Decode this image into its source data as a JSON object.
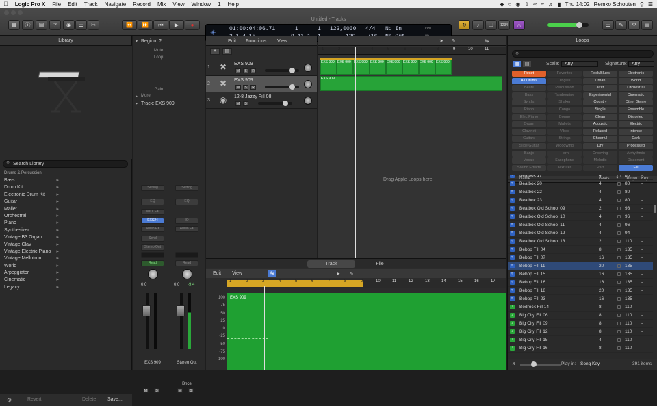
{
  "menubar": {
    "apple": "",
    "app": "Logic Pro X",
    "items": [
      "File",
      "Edit",
      "Track",
      "Navigate",
      "Record",
      "Mix",
      "View",
      "Window",
      "1",
      "Help"
    ],
    "clock": "Thu 14:02",
    "user": "Remko Schouten"
  },
  "window_title": "Untitled - Tracks",
  "lcd": {
    "time": "01:00:04:06.71",
    "bars1": "1",
    "time_end": "1",
    "tempo": "123,0000",
    "signature": "4/4",
    "midi_in": "No In",
    "position": "3  1  4     15",
    "bars2": "9  11  1",
    "bars3": "1",
    "tempo2": "129",
    "division": "/16",
    "midi_out": "No Out",
    "cpu": "CPU",
    "hd": "HD"
  },
  "library": {
    "title": "Library",
    "search_placeholder": "Search Library",
    "category": "Drums & Percussion",
    "items": [
      "Bass",
      "Drum Kit",
      "Electronic Drum Kit",
      "Guitar",
      "Mallet",
      "Orchestral",
      "Piano",
      "Synthesizer",
      "Vintage B3 Organ",
      "Vintage Clav",
      "Vintage Electric Piano",
      "Vintage Mellotron",
      "World",
      "Arpeggiator",
      "Cinematic",
      "Legacy"
    ],
    "revert": "Revert",
    "delete": "Delete",
    "save": "Save..."
  },
  "inspector": {
    "region": "Region: ?",
    "mute": "Mute:",
    "loop": "Loop:",
    "gain": "Gain:",
    "more": "More",
    "track": "Track:  EXS 909",
    "strip1": {
      "setting": "Setting",
      "eq": "EQ",
      "midi_fx": "MIDI FX",
      "instrument": "EXS24",
      "audio_fx": "Audio FX",
      "send": "Send",
      "output": "Stereo Out",
      "read": "Read",
      "vol": "0,0",
      "pan": "0,0",
      "name": "EXS 909",
      "m": "M",
      "s": "S"
    },
    "strip2": {
      "setting": "Setting",
      "eq": "EQ",
      "instrument": "IO",
      "audio_fx": "Audio FX",
      "read": "Read",
      "vol": "0,0",
      "peak": "-9,4",
      "bnce": "Bnce",
      "name": "Stereo Out",
      "m": "M",
      "s": "S"
    }
  },
  "tracks_header": {
    "edit": "Edit",
    "functions": "Functions",
    "view": "View"
  },
  "tracks": [
    {
      "num": "1",
      "name": "EXS 909",
      "m": "M",
      "s": "S",
      "r": "R"
    },
    {
      "num": "2",
      "name": "EXS 909",
      "m": "M",
      "s": "S",
      "r": "R"
    },
    {
      "num": "3",
      "name": "12-8 Jazzy Fill 08",
      "m": "M",
      "s": "S",
      "r": ""
    }
  ],
  "arrange": {
    "ruler": [
      "1",
      "2",
      "3",
      "4",
      "5",
      "6",
      "7",
      "8",
      "9",
      "10",
      "11"
    ],
    "region_label": "EXS 909",
    "region2_label": "EXS 909",
    "drag_hint": "Drag Apple Loops here."
  },
  "bottom": {
    "tab_track": "Track",
    "tab_file": "File",
    "edit": "Edit",
    "view": "View",
    "ruler": [
      "1",
      "2",
      "3",
      "4",
      "5",
      "6",
      "7",
      "8",
      "9",
      "10",
      "11",
      "12",
      "13",
      "14",
      "15",
      "16",
      "17"
    ],
    "region": "EXS 909",
    "scale": [
      "100",
      "75",
      "50",
      "25",
      "0",
      "-25",
      "-50",
      "-75",
      "-100"
    ]
  },
  "loops": {
    "title": "Loops",
    "scale_label": "Scale:",
    "scale_value": "Any",
    "sig_label": "Signature:",
    "sig_value": "Any",
    "tags_left": [
      [
        "Reset",
        "Favorites"
      ],
      [
        "All Drums",
        "Jingles"
      ],
      [
        "Beats",
        "Percussion"
      ],
      [
        "Bass",
        "Tambourine"
      ],
      [
        "Synths",
        "Shaker"
      ],
      [
        "Piano",
        "Conga"
      ],
      [
        "Elec Piano",
        "Bongo"
      ],
      [
        "Organ",
        "Mallets"
      ],
      [
        "Clavinet",
        "Vibes"
      ],
      [
        "Guitars",
        "Strings"
      ],
      [
        "Slide Guitar",
        "Woodwind"
      ],
      [
        "Banjo",
        "Horn"
      ],
      [
        "Vocals",
        "Saxophone"
      ],
      [
        "Sound Effects",
        "Textures"
      ]
    ],
    "tags_right": [
      [
        "Rock/Blues",
        "Electronic"
      ],
      [
        "Urban",
        "World"
      ],
      [
        "Jazz",
        "Orchestral"
      ],
      [
        "Experimental",
        "Cinematic"
      ],
      [
        "Country",
        "Other Genre"
      ],
      [
        "Single",
        "Ensemble"
      ],
      [
        "Clean",
        "Distorted"
      ],
      [
        "Acoustic",
        "Electric"
      ],
      [
        "Relaxed",
        "Intense"
      ],
      [
        "Cheerful",
        "Dark"
      ],
      [
        "Dry",
        "Processed"
      ],
      [
        "Grooving",
        "Arrhythmic"
      ],
      [
        "Melodic",
        "Dissonant"
      ],
      [
        "Part",
        "Fill"
      ]
    ],
    "col_name": "Name",
    "col_beats": "Beats",
    "col_tempo": "Tempo",
    "col_key": "Key",
    "rows": [
      {
        "name": "Beatbox 17",
        "beats": "4",
        "tempo": "80",
        "key": "-",
        "type": "audio"
      },
      {
        "name": "Beatbox 20",
        "beats": "4",
        "tempo": "80",
        "key": "-",
        "type": "audio"
      },
      {
        "name": "Beatbox 22",
        "beats": "4",
        "tempo": "80",
        "key": "-",
        "type": "audio"
      },
      {
        "name": "Beatbox 23",
        "beats": "4",
        "tempo": "80",
        "key": "-",
        "type": "audio"
      },
      {
        "name": "Beatbox Old School 09",
        "beats": "2",
        "tempo": "98",
        "key": "-",
        "type": "audio"
      },
      {
        "name": "Beatbox Old School 10",
        "beats": "4",
        "tempo": "96",
        "key": "-",
        "type": "audio"
      },
      {
        "name": "Beatbox Old School 11",
        "beats": "4",
        "tempo": "96",
        "key": "-",
        "type": "audio"
      },
      {
        "name": "Beatbox Old School 12",
        "beats": "4",
        "tempo": "94",
        "key": "-",
        "type": "audio"
      },
      {
        "name": "Beatbox Old School 13",
        "beats": "2",
        "tempo": "110",
        "key": "-",
        "type": "audio"
      },
      {
        "name": "Bebop Fill 04",
        "beats": "8",
        "tempo": "135",
        "key": "-",
        "type": "audio"
      },
      {
        "name": "Bebop Fill 07",
        "beats": "16",
        "tempo": "135",
        "key": "-",
        "type": "audio"
      },
      {
        "name": "Bebop Fill 11",
        "beats": "20",
        "tempo": "135",
        "key": "-",
        "type": "audio"
      },
      {
        "name": "Bebop Fill 15",
        "beats": "16",
        "tempo": "135",
        "key": "-",
        "type": "audio"
      },
      {
        "name": "Bebop Fill 16",
        "beats": "16",
        "tempo": "135",
        "key": "-",
        "type": "audio"
      },
      {
        "name": "Bebop Fill 18",
        "beats": "20",
        "tempo": "135",
        "key": "-",
        "type": "audio"
      },
      {
        "name": "Bebop Fill 23",
        "beats": "16",
        "tempo": "135",
        "key": "-",
        "type": "audio"
      },
      {
        "name": "Bedrock Fill 14",
        "beats": "8",
        "tempo": "110",
        "key": "-",
        "type": "midi"
      },
      {
        "name": "Big City Fill 06",
        "beats": "8",
        "tempo": "110",
        "key": "-",
        "type": "midi"
      },
      {
        "name": "Big City Fill 09",
        "beats": "8",
        "tempo": "110",
        "key": "-",
        "type": "midi"
      },
      {
        "name": "Big City Fill 12",
        "beats": "8",
        "tempo": "110",
        "key": "-",
        "type": "midi"
      },
      {
        "name": "Big City Fill 15",
        "beats": "4",
        "tempo": "110",
        "key": "-",
        "type": "midi"
      },
      {
        "name": "Big City Fill 16",
        "beats": "8",
        "tempo": "110",
        "key": "-",
        "type": "midi"
      }
    ],
    "play_in_label": "Play in:",
    "play_in_value": "Song Key",
    "count": "391 items"
  },
  "colors": {
    "accent": "#4b7bd4",
    "region": "#27a338",
    "cycle": "#d6a624"
  }
}
